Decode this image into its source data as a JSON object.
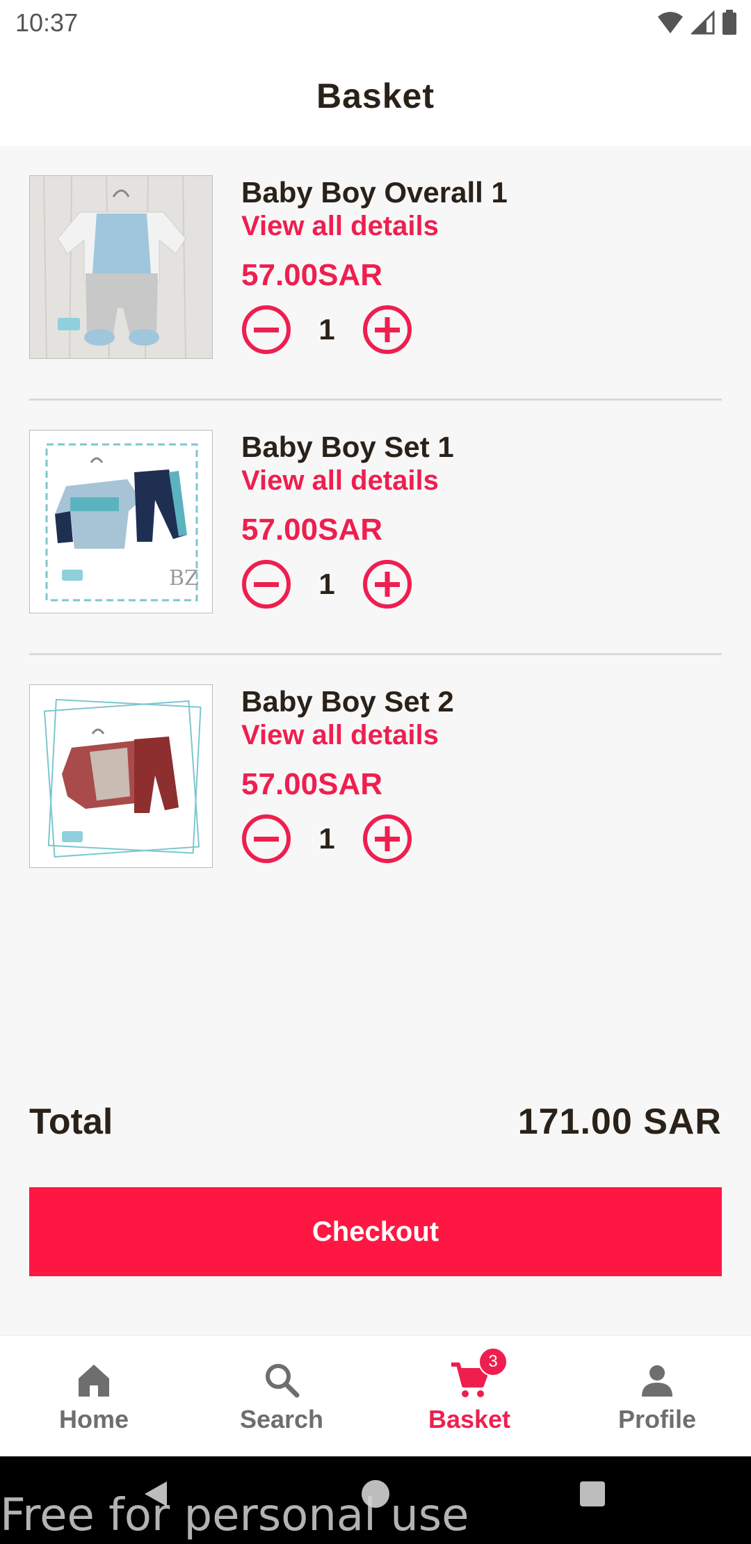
{
  "status": {
    "time": "10:37",
    "icons": [
      "wifi-icon",
      "signal-icon",
      "battery-icon"
    ]
  },
  "header": {
    "title": "Basket"
  },
  "basket": {
    "items": [
      {
        "name": "Baby Boy Overall 1",
        "details_label": "View all details",
        "price": "57.00SAR",
        "quantity": "1",
        "image": "baby-overall-photo"
      },
      {
        "name": "Baby Boy Set 1",
        "details_label": "View all details",
        "price": "57.00SAR",
        "quantity": "1",
        "image": "baby-set-believe-photo"
      },
      {
        "name": "Baby Boy Set 2",
        "details_label": "View all details",
        "price": "57.00SAR",
        "quantity": "1",
        "image": "baby-set-red-photo"
      }
    ]
  },
  "summary": {
    "total_label": "Total",
    "total_value": "171.00 SAR"
  },
  "checkout_label": "Checkout",
  "nav": {
    "items": [
      {
        "label": "Home",
        "icon": "home-icon"
      },
      {
        "label": "Search",
        "icon": "search-icon"
      },
      {
        "label": "Basket",
        "icon": "cart-icon",
        "badge": "3",
        "active": true
      },
      {
        "label": "Profile",
        "icon": "person-icon"
      }
    ]
  },
  "watermark": "Free for personal use",
  "colors": {
    "accent": "#ee1f4f",
    "checkout": "#ff1744",
    "text": "#2a2118",
    "background": "#f7f7f7"
  }
}
